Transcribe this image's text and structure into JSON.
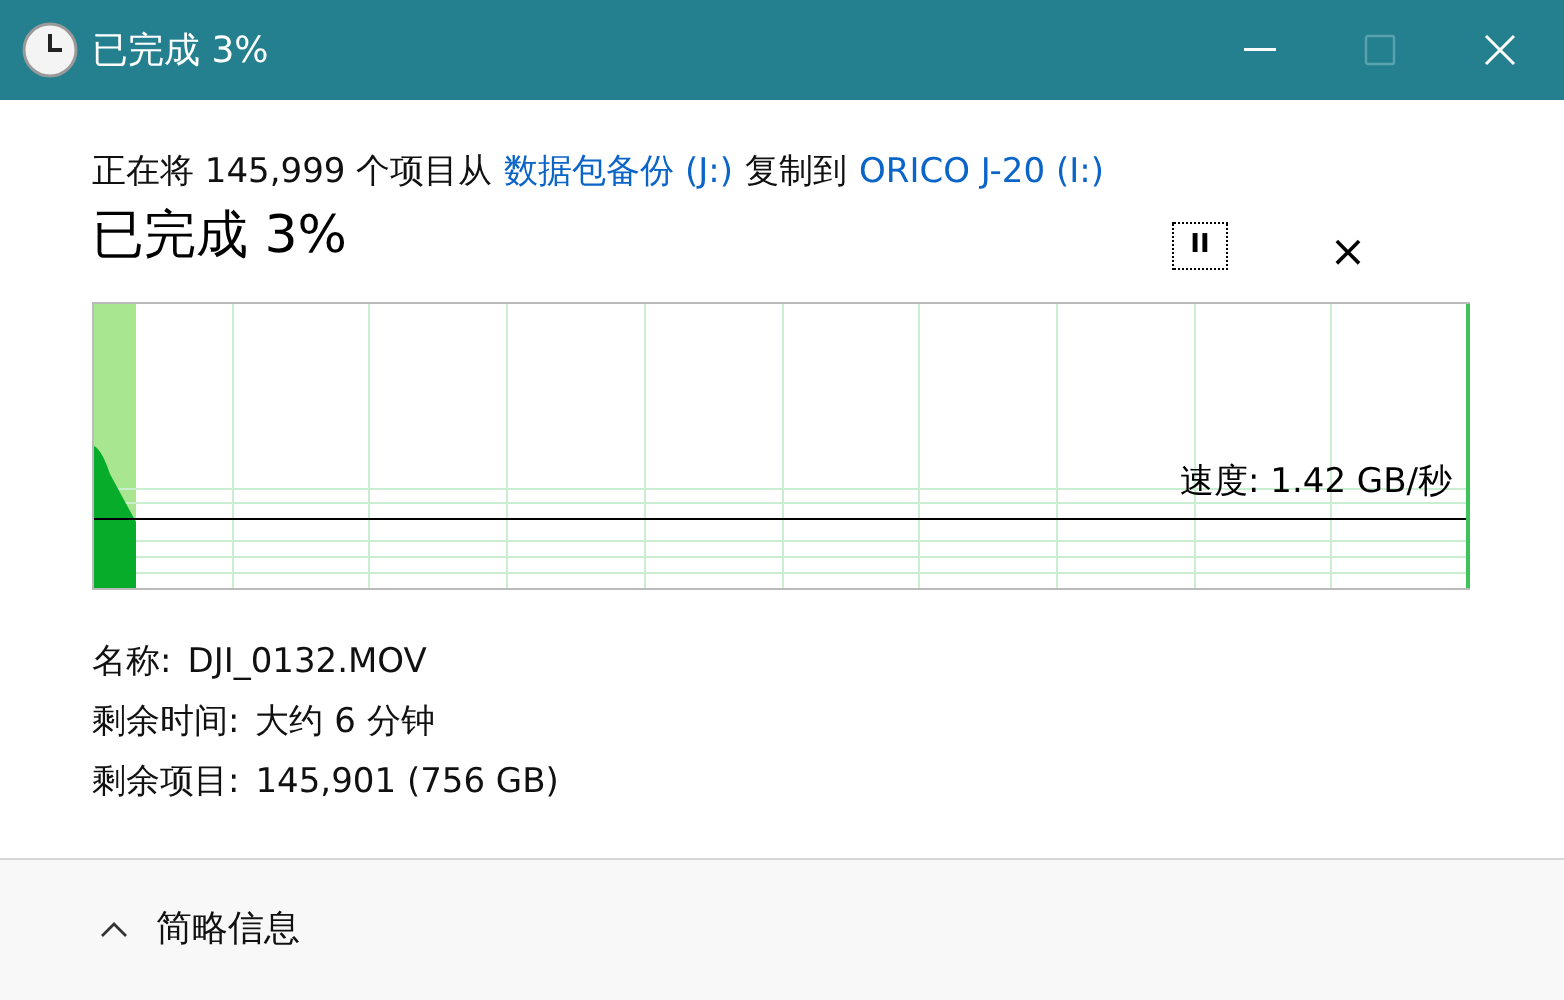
{
  "window": {
    "title": "已完成 3%"
  },
  "copy_line": {
    "prefix": "正在将 145,999 个项目从",
    "source": "数据包备份 (J:)",
    "middle": "复制到",
    "destination": "ORICO J-20 (I:)"
  },
  "heading": "已完成 3%",
  "controls": {
    "pause": "II",
    "cancel": "×"
  },
  "progress": {
    "level": 0.03,
    "speed": "速度: 1.42 GB/秒"
  },
  "details": [
    {
      "label": "名称:",
      "value": "DJI_0132.MOV"
    },
    {
      "label": "剩余时间:",
      "value": "大约 6 分钟"
    },
    {
      "label": "剩余项目:",
      "value": "145,901 (756 GB)"
    }
  ],
  "footer": {
    "toggle": "简略信息",
    "expanded": true
  }
}
